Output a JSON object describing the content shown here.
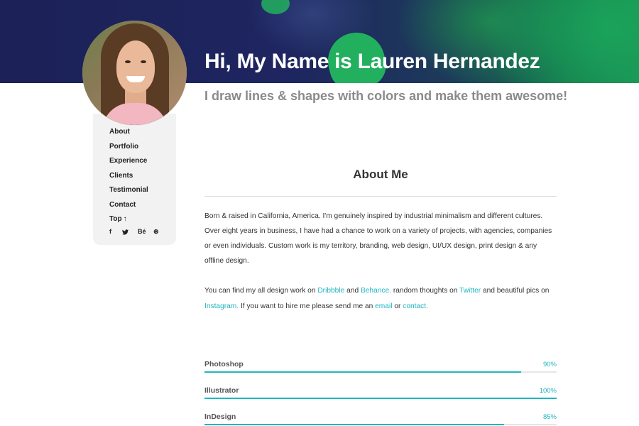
{
  "hero": {
    "title": "Hi, My Name is Lauren Hernandez",
    "subtitle": "I draw lines & shapes with colors and make them awesome!"
  },
  "sidebar": {
    "nav": [
      {
        "label": "About"
      },
      {
        "label": "Portfolio"
      },
      {
        "label": "Experience"
      },
      {
        "label": "Clients"
      },
      {
        "label": "Testimonial"
      },
      {
        "label": "Contact"
      },
      {
        "label": "Top",
        "icon": "arrow-up-icon"
      }
    ],
    "social": [
      {
        "label": "f",
        "icon": "facebook-icon"
      },
      {
        "label": "•",
        "icon": "twitter-icon"
      },
      {
        "label": "Bé",
        "icon": "behance-icon"
      },
      {
        "label": "⊛",
        "icon": "dribbble-icon"
      }
    ]
  },
  "about": {
    "title": "About Me",
    "para1": "Born & raised in California, America. I'm genuinely inspired by industrial minimalism and different cultures. Over eight years in business, I have had a chance to work on a variety of projects, with agencies, companies or even individuals. Custom work is my territory, branding, web design, UI/UX design, print design & any offline design.",
    "para2": {
      "t1": "You can find my all design work on ",
      "dribbble": "Dribbble",
      "t2": " and ",
      "behance": "Behance.",
      "t3": " random thoughts on ",
      "twitter": "Twitter",
      "t4": " and beautiful pics on ",
      "instagram": "Instagram.",
      "t5": " If you want to hire me please send me an ",
      "email": "email",
      "t6": " or ",
      "contact": "contact."
    }
  },
  "skills": [
    {
      "name": "Photoshop",
      "percent_label": "90%",
      "value": 0.9
    },
    {
      "name": "Illustrator",
      "percent_label": "100%",
      "value": 1.0
    },
    {
      "name": "InDesign",
      "percent_label": "85%",
      "value": 0.85
    }
  ],
  "colors": {
    "accent": "#1fb5c2",
    "hero_dark": "#1c2257",
    "hero_green": "#1b8f55"
  }
}
